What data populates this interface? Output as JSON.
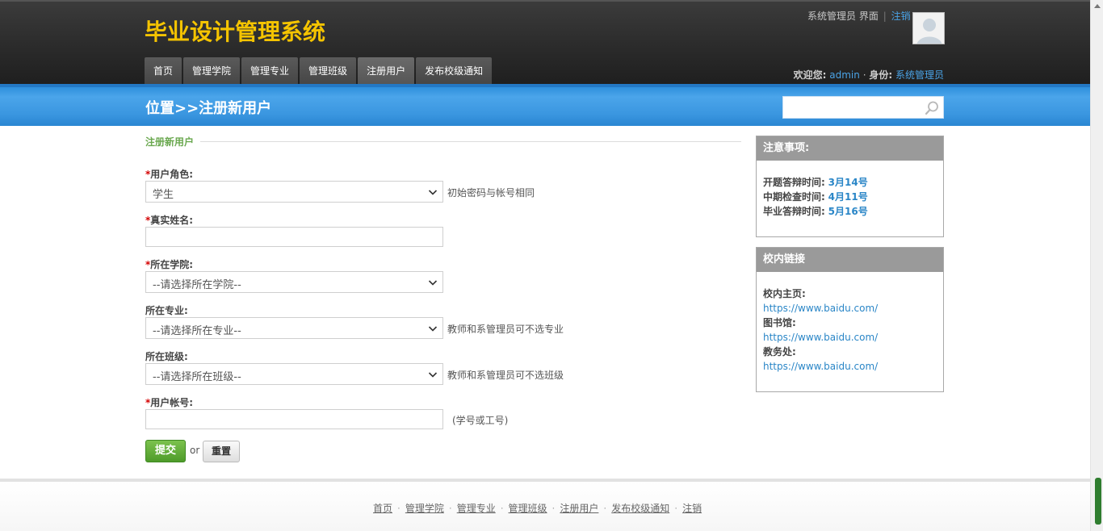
{
  "header": {
    "logo": "毕业设计管理系统",
    "top_links": {
      "system": "系统管理员",
      "interface": "界面",
      "logout": "注销"
    },
    "nav": [
      "首页",
      "管理学院",
      "管理专业",
      "管理班级",
      "注册用户",
      "发布校级通知"
    ],
    "welcome_label": "欢迎您:",
    "username": "admin",
    "role_label": "身份:",
    "role": "系统管理员"
  },
  "titlebar": {
    "title": "位置>>注册新用户",
    "search_placeholder": ""
  },
  "form": {
    "section_title": "注册新用户",
    "role_label": "用户角色:",
    "role_value": "学生",
    "role_hint": "初始密码与帐号相同",
    "realname_label": "真实姓名:",
    "realname_value": "",
    "college_label": "所在学院:",
    "college_value": "--请选择所在学院--",
    "major_label": "所在专业:",
    "major_value": "--请选择所在专业--",
    "major_hint": "教师和系管理员可不选专业",
    "class_label": "所在班级:",
    "class_value": "--请选择所在班级--",
    "class_hint": "教师和系管理员可不选班级",
    "account_label": "用户帐号:",
    "account_value": "",
    "account_hint": "(学号或工号)",
    "submit": "提交",
    "or": "or",
    "reset": "重置"
  },
  "notice_panel": {
    "title": "注意事项:",
    "items": [
      {
        "label": "开题答辩时间:",
        "value": "3月14号"
      },
      {
        "label": "中期检查时间:",
        "value": "4月11号"
      },
      {
        "label": "毕业答辩时间:",
        "value": "5月16号"
      }
    ]
  },
  "links_panel": {
    "title": "校内链接",
    "items": [
      {
        "label": "校内主页:",
        "url": "https://www.baidu.com/"
      },
      {
        "label": "图书馆:",
        "url": "https://www.baidu.com/"
      },
      {
        "label": "教务处:",
        "url": "https://www.baidu.com/"
      }
    ]
  },
  "footer": {
    "links": [
      "首页",
      "管理学院",
      "管理专业",
      "管理班级",
      "注册用户",
      "发布校级通知",
      "注销"
    ]
  },
  "colors": {
    "logo": "#f5c400",
    "accent_blue": "#3a96e0",
    "link": "#2a86c7",
    "submit_green": "#5aa834",
    "required": "#d40000"
  }
}
